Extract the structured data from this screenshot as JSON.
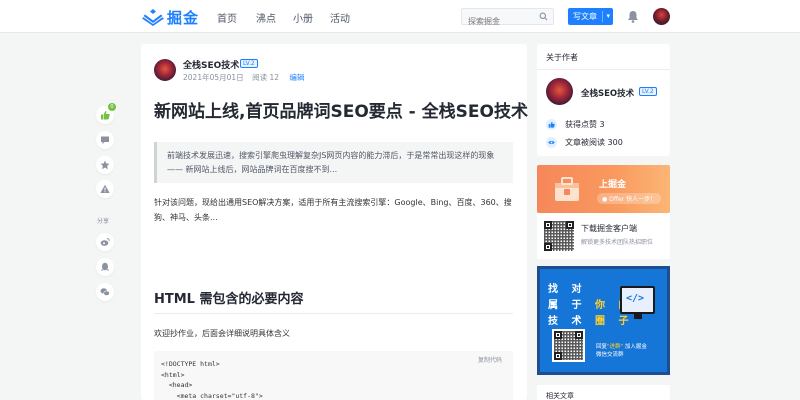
{
  "header": {
    "logo_text": "掘金",
    "nav": [
      "首页",
      "沸点",
      "小册",
      "活动"
    ],
    "search_placeholder": "探索掘金",
    "write_label": "写文章"
  },
  "sidebar_left": {
    "like_count": "0",
    "share_label": "分享"
  },
  "article": {
    "author": "全栈SEO技术",
    "author_level": "LV.2",
    "date": "2021年05月01日",
    "reads": "阅读 12",
    "edit_label": "编辑",
    "title": "新网站上线,首页品牌词SEO要点 - 全栈SEO技术",
    "quote": "前端技术发展迅速，搜索引擎爬虫理解复杂JS网页内容的能力滞后，于是常常出现这样的现象 —— 新网站上线后，网站品牌词在百度搜不到...",
    "para1": "针对该问题，现给出通用SEO解决方案，适用于所有主流搜索引擎：Google、Bing、百度、360、搜狗、神马、头条...",
    "h2": "HTML 需包含的必要内容",
    "para2": "欢迎抄作业，后面会详细说明具体含义",
    "copy_label": "复制代码",
    "code": "<!DOCTYPE html>\n<html>\n  <head>\n    <meta charset=\"utf-8\">\n    <meta name=\"viewport\" content=\"width=device-width, initial-scale=1\">\n    <meta name=\"applicable-device\" content=\"pc,mobile\">\n    <meta http-equiv=\"Cache-Control\" content=\"no-transform\">"
  },
  "about_author": {
    "title": "关于作者",
    "name": "全栈SEO技术",
    "level": "LV.2",
    "likes": "获得点赞 3",
    "reads": "文章被阅读 300"
  },
  "promo": {
    "title": "上掘金",
    "pill": "● Offer 快人一步！"
  },
  "app": {
    "title": "下载掘金客户端",
    "sub": "解锁更多技术团队热招职位"
  },
  "ad": {
    "line1": "找 对",
    "line2a": "属 于",
    "line2b": "你 的",
    "line3": "技 术",
    "line3b": "圈 子",
    "bottom1a": "回复",
    "bottom1b": "\"进群\"",
    "bottom1c": "加入掘金",
    "bottom2": "微信交流群"
  },
  "related": {
    "title": "相关文章"
  },
  "colors": {
    "accent": "#1e80ff",
    "like_green": "#72c140",
    "promo_orange": "#f6875a"
  }
}
